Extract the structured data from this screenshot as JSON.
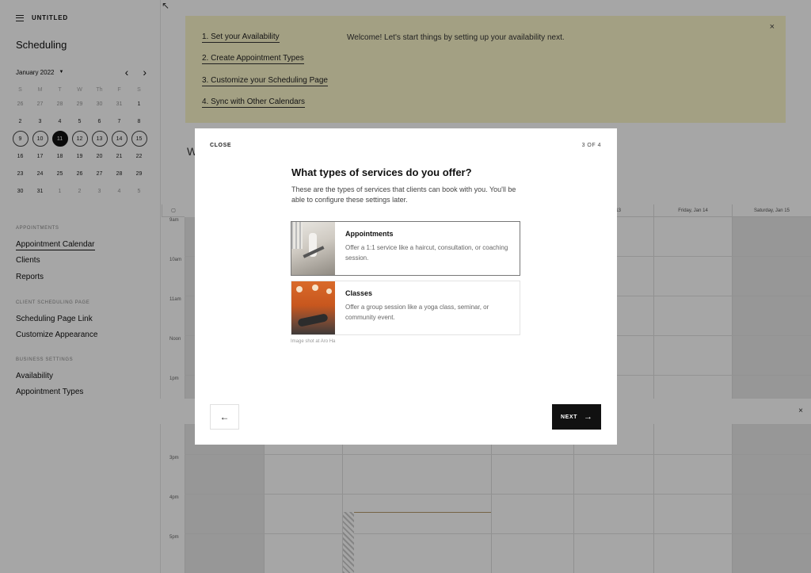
{
  "sidebar": {
    "site_name": "UNTITLED",
    "title": "Scheduling",
    "calendar": {
      "month_label": "January 2022",
      "weekdays": [
        "S",
        "M",
        "T",
        "W",
        "Th",
        "F",
        "S"
      ],
      "weeks": [
        [
          "26",
          "27",
          "28",
          "29",
          "30",
          "31",
          "1"
        ],
        [
          "2",
          "3",
          "4",
          "5",
          "6",
          "7",
          "8"
        ],
        [
          "9",
          "10",
          "11",
          "12",
          "13",
          "14",
          "15"
        ],
        [
          "16",
          "17",
          "18",
          "19",
          "20",
          "21",
          "22"
        ],
        [
          "23",
          "24",
          "25",
          "26",
          "27",
          "28",
          "29"
        ],
        [
          "30",
          "31",
          "1",
          "2",
          "3",
          "4",
          "5"
        ]
      ],
      "today": "11"
    },
    "sections": {
      "appointments": "APPOINTMENTS",
      "client_page": "CLIENT SCHEDULING PAGE",
      "business": "BUSINESS SETTINGS"
    },
    "links": {
      "appointment_calendar": "Appointment Calendar",
      "clients": "Clients",
      "reports": "Reports",
      "scheduling_page_link": "Scheduling Page Link",
      "customize_appearance": "Customize Appearance",
      "availability": "Availability",
      "appointment_types": "Appointment Types"
    }
  },
  "banner": {
    "steps": [
      "1. Set your Availability",
      "2. Create Appointment Types",
      "3. Customize your Scheduling Page",
      "4. Sync with Other Calendars"
    ],
    "welcome": "Welcome! Let's start things by setting up your availability next.",
    "close": "×"
  },
  "background": {
    "heading_partial": "W",
    "columns": [
      "Jan 13",
      "Friday, Jan 14",
      "Saturday, Jan 15"
    ],
    "times": [
      "9am",
      "10am",
      "11am",
      "Noon",
      "1pm",
      "3pm",
      "4pm",
      "5pm"
    ],
    "strip_close": "×"
  },
  "modal": {
    "close_label": "CLOSE",
    "step": "3 OF 4",
    "title": "What types of services do you offer?",
    "description": "These are the types of services that clients can book with you. You'll be able to configure these settings later.",
    "options": [
      {
        "title": "Appointments",
        "text": "Offer a 1:1 service like a haircut, consultation, or coaching session."
      },
      {
        "title": "Classes",
        "text": "Offer a group session like a yoga class, seminar, or community event."
      }
    ],
    "image_credit": "Image shot at Aro Ha",
    "back_symbol": "←",
    "next_label": "NEXT",
    "next_symbol": "→"
  },
  "icons": {
    "expand": "↖",
    "prev": "‹",
    "next": "›",
    "caret": "▼"
  }
}
